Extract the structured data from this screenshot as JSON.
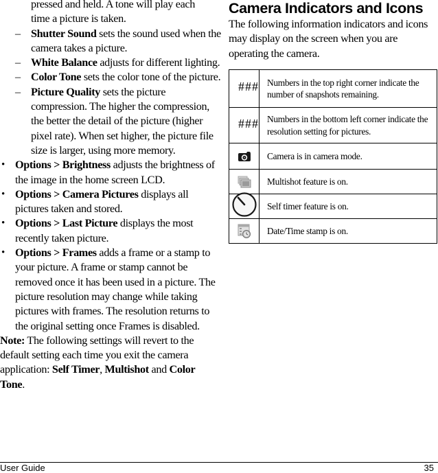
{
  "left_column": {
    "continuation": [
      "pressed and held. A tone will play each",
      "time a picture is taken."
    ],
    "sub_items": [
      {
        "bold": "Shutter Sound",
        "text": " sets the sound used when the camera takes a picture."
      },
      {
        "bold": "White Balance",
        "text": " adjusts for different lighting."
      },
      {
        "bold": "Color Tone",
        "text": " sets the color tone of the picture."
      },
      {
        "bold": "Picture Quality",
        "text": " sets the picture compression. The higher the compression, the better the detail of the picture (higher pixel rate). When set higher, the picture file size is larger, using more memory."
      }
    ],
    "bullets": [
      {
        "bold": "Options > Brightness",
        "text": " adjusts the brightness of the image in the home screen LCD."
      },
      {
        "bold": "Options > Camera Pictures",
        "text": " displays all pictures taken and stored."
      },
      {
        "bold": "Options > Last Picture",
        "text": " displays the most recently taken picture."
      },
      {
        "bold": "Options > Frames",
        "text": " adds a frame or a stamp to your picture. A frame or stamp cannot be removed once it has been used in a picture. The picture resolution may change while taking pictures with frames. The resolution returns to the original setting once Frames is disabled."
      }
    ],
    "note": {
      "label": "Note:",
      "text1": " The following settings will revert to the default setting each time you exit the camera application: ",
      "item1": "Self Timer",
      "sep1": ", ",
      "item2": "Multishot",
      "sep2": " and ",
      "item3": "Color Tone",
      "end": "."
    },
    "dash_mark": "–",
    "bullet_mark": "•"
  },
  "right_column": {
    "title": "Camera Indicators and Icons",
    "intro": "The following information indicators and icons may display on the screen when you are operating the camera.",
    "table": [
      {
        "icon": "###",
        "icon_name": "snapshots-remaining-indicator",
        "text": "Numbers in the top right corner indicate the number of snapshots remaining."
      },
      {
        "icon": "###",
        "icon_name": "resolution-indicator",
        "text": "Numbers in the bottom left corner indicate the resolution setting for pictures."
      },
      {
        "icon": "camera-icon",
        "icon_name": "camera-icon",
        "text": "Camera is in camera mode."
      },
      {
        "icon": "multishot-icon",
        "icon_name": "multishot-icon",
        "text": "Multishot feature is on."
      },
      {
        "icon": "self-timer-icon",
        "icon_name": "self-timer-icon",
        "text": "Self timer feature is on."
      },
      {
        "icon": "date-time-stamp-icon",
        "icon_name": "date-time-stamp-icon",
        "text": "Date/Time stamp is on."
      }
    ]
  },
  "footer": {
    "left": "User Guide",
    "page_number": "35"
  }
}
